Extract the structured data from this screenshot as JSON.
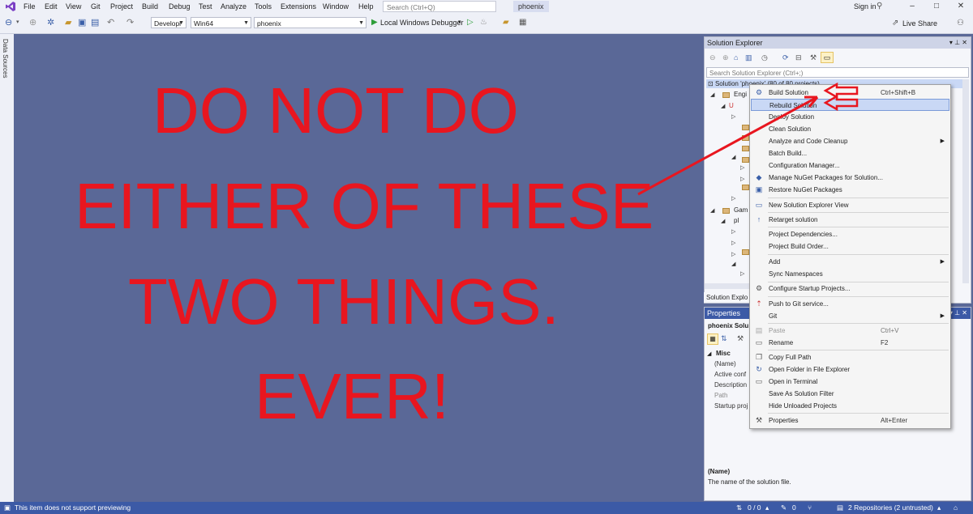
{
  "menubar": {
    "items": [
      "File",
      "Edit",
      "View",
      "Git",
      "Project",
      "Build",
      "Debug",
      "Test",
      "Analyze",
      "Tools",
      "Extensions",
      "Window",
      "Help"
    ],
    "search_placeholder": "Search (Ctrl+Q)",
    "solution_name": "phoenix",
    "sign_in": "Sign in",
    "window_controls": [
      "–",
      "□",
      "✕"
    ]
  },
  "toolbar": {
    "config": "Developi",
    "platform": "Win64",
    "startup_project": "phoenix",
    "debugger": "Local Windows Debugger",
    "live_share": "Live Share"
  },
  "left_strip": {
    "label": "Data Sources"
  },
  "overlay": {
    "lines": [
      "DO NOT DO",
      "EITHER OF THESE",
      "TWO THINGS.",
      "EVER!"
    ],
    "color": "#e8161f"
  },
  "solution_explorer": {
    "title": "Solution Explorer",
    "search_placeholder": "Search Solution Explorer (Ctrl+;)",
    "root": "Solution 'phoenix' (80 of 80 projects)",
    "tree": [
      {
        "label": "Engi"
      },
      {
        "label": "U"
      },
      {
        "label": ""
      },
      {
        "label": "Gam"
      },
      {
        "label": "pl"
      }
    ],
    "tab": "Solution Explo"
  },
  "properties": {
    "title": "Properties",
    "object": "phoenix  Solu",
    "category": "Misc",
    "rows": [
      "(Name)",
      "Active conf",
      "Description",
      "Path",
      "Startup proj"
    ],
    "desc_name": "(Name)",
    "desc_text": "The name of the solution file."
  },
  "context_menu": {
    "items": [
      {
        "label": "Build Solution",
        "shortcut": "Ctrl+Shift+B",
        "icon": "build-icon"
      },
      {
        "label": "Rebuild Solution",
        "shortcut": "",
        "icon": "",
        "highlighted": true
      },
      {
        "label": "Deploy Solution",
        "shortcut": ""
      },
      {
        "label": "Clean Solution",
        "shortcut": ""
      },
      {
        "label": "Analyze and Code Cleanup",
        "shortcut": "",
        "submenu": true
      },
      {
        "label": "Batch Build...",
        "shortcut": ""
      },
      {
        "label": "Configuration Manager...",
        "shortcut": ""
      },
      {
        "label": "Manage NuGet Packages for Solution...",
        "shortcut": "",
        "icon": "nuget-icon"
      },
      {
        "label": "Restore NuGet Packages",
        "shortcut": "",
        "icon": "restore-icon"
      },
      {
        "label": "New Solution Explorer View",
        "shortcut": "",
        "icon": "new-view-icon"
      },
      {
        "label": "Retarget solution",
        "shortcut": "",
        "icon": "retarget-icon"
      },
      {
        "label": "Project Dependencies...",
        "shortcut": ""
      },
      {
        "label": "Project Build Order...",
        "shortcut": ""
      },
      {
        "label": "Add",
        "shortcut": "",
        "submenu": true
      },
      {
        "label": "Sync Namespaces",
        "shortcut": ""
      },
      {
        "label": "Configure Startup Projects...",
        "shortcut": "",
        "icon": "gear-icon"
      },
      {
        "label": "Push to Git service...",
        "shortcut": "",
        "icon": "git-push-icon"
      },
      {
        "label": "Git",
        "shortcut": "",
        "submenu": true
      },
      {
        "label": "Paste",
        "shortcut": "Ctrl+V",
        "disabled": true,
        "icon": "paste-icon"
      },
      {
        "label": "Rename",
        "shortcut": "F2",
        "icon": "rename-icon"
      },
      {
        "label": "Copy Full Path",
        "shortcut": "",
        "icon": "copy-icon"
      },
      {
        "label": "Open Folder in File Explorer",
        "shortcut": "",
        "icon": "open-folder-icon"
      },
      {
        "label": "Open in Terminal",
        "shortcut": "",
        "icon": "terminal-icon"
      },
      {
        "label": "Save As Solution Filter",
        "shortcut": ""
      },
      {
        "label": "Hide Unloaded Projects",
        "shortcut": ""
      },
      {
        "label": "Properties",
        "shortcut": "Alt+Enter",
        "icon": "wrench-icon"
      }
    ]
  },
  "statusbar": {
    "message": "This item does not support previewing",
    "sync": "0 / 0",
    "edits": "0",
    "branch": "2 Repositories (2 untrusted)"
  }
}
